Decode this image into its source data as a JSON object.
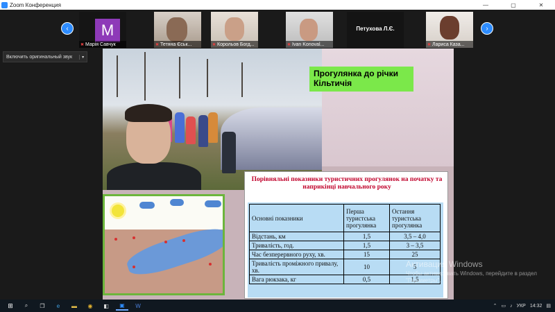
{
  "window": {
    "title": "Zoom Конференция",
    "controls": [
      "—",
      "▢",
      "✕"
    ]
  },
  "participants": [
    {
      "name": "Марія Савчук",
      "avatar_letter": "M",
      "avatar_color": "#8e3ab8"
    },
    {
      "name": "Тетяна Єськ...",
      "video": true
    },
    {
      "name": "Корольов Богд...",
      "video": true
    },
    {
      "name": "Ivan Konoval...",
      "video": true
    },
    {
      "name": "Петухова Л.Є.",
      "label_only": true
    },
    {
      "name": "Лариса Каза...",
      "video": true
    }
  ],
  "nav": {
    "prev": "‹",
    "next": "›"
  },
  "original_sound": {
    "label": "Включить оригинальный звук",
    "dropdown": "▾"
  },
  "slide": {
    "title": "Прогулянка до річки Кільтичія",
    "table_title": "Порівняльні показники туристичних прогулянок на початку та наприкінці навчального року",
    "headers": [
      "Основні показники",
      "Перша туристська прогулянка",
      "Остання туристська прогулянка"
    ],
    "rows": [
      [
        "Відстань, км",
        "1,5",
        "3,5 – 4,0"
      ],
      [
        "Тривалість, год.",
        "1,5",
        "3 – 3,5"
      ],
      [
        "Час безперервного руху, хв.",
        "15",
        "25"
      ],
      [
        "Тривалість проміжного привалу, хв.",
        "10",
        "5"
      ],
      [
        "Вага рюкзака, кг",
        "0,5",
        "1,5"
      ]
    ]
  },
  "watermark": {
    "title": "Активация Windows",
    "text": "Чтобы активировать Windows, перейдите в раздел \"Параметры\"."
  },
  "taskbar": {
    "lang": "УКР",
    "time": "14:32"
  },
  "colors": {
    "accent": "#2d8cff",
    "title_green": "#7be84a",
    "table_title_red": "#c0002a",
    "table_bg": "#b8dcf4"
  }
}
